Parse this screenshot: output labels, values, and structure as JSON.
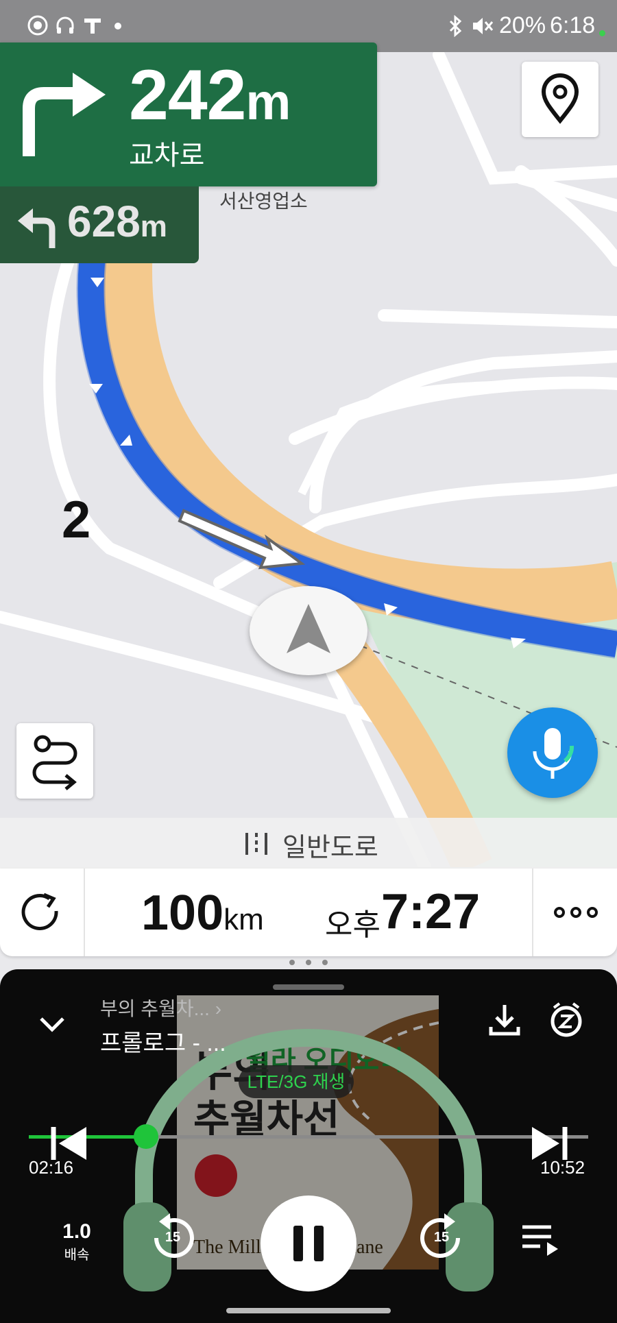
{
  "status": {
    "battery": "20%",
    "time": "6:18",
    "icons": [
      "whatsapp-icon",
      "headphones-icon",
      "t-icon",
      "dot-icon",
      "bluetooth-icon",
      "mute-icon"
    ]
  },
  "navigation": {
    "primary": {
      "distance": "242",
      "unit": "m",
      "label": "교차로",
      "icon": "turn-right-icon"
    },
    "secondary": {
      "distance": "628",
      "unit": "m",
      "icon": "turn-left-icon"
    },
    "map_labels": {
      "place": "서산영업소",
      "road_number": "2"
    },
    "road_type": "일반도로",
    "remaining_distance": "100",
    "remaining_unit": "km",
    "eta_period": "오후",
    "eta_time": "7:27"
  },
  "player": {
    "book_title": "부의 추월차...",
    "chapter": "프롤로그 - ...",
    "network_badge": "LTE/3G 재생",
    "cover_title_line1": "부의",
    "cover_title_line2": "추월차선",
    "cover_overlay": "윌라 오디오북",
    "cover_subtitle": "The Millionaire Fastlane",
    "elapsed": "02:16",
    "duration": "10:52",
    "progress": 0.21,
    "speed_value": "1.0",
    "speed_label": "배속",
    "rewind_seconds": "15",
    "forward_seconds": "15"
  },
  "colors": {
    "route": "#2f6ee8",
    "primary_panel": "#1e6e44",
    "accent_green": "#1fc43a",
    "mic": "#1a8fe6"
  }
}
